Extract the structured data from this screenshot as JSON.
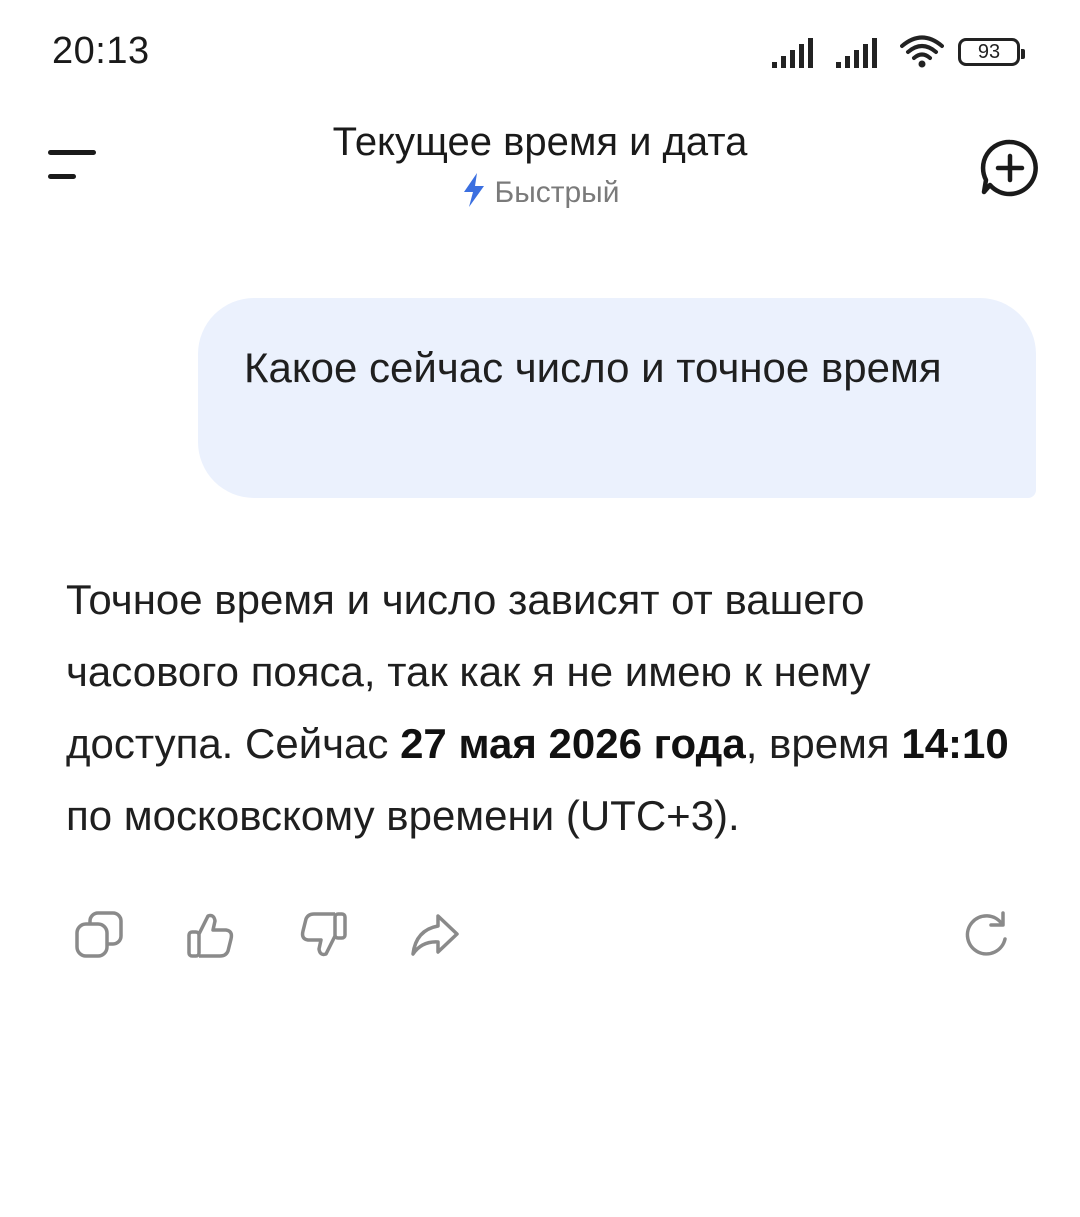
{
  "status_bar": {
    "time": "20:13",
    "battery": "93",
    "icons": [
      "signal-icon",
      "signal-icon",
      "wifi-icon",
      "battery-icon"
    ]
  },
  "header": {
    "title": "Текущее время и дата",
    "mode_label": "Быстрый",
    "mode_icon": "lightning-icon",
    "accent_color": "#3b6fe0"
  },
  "conversation": {
    "user_message": "Какое сейчас число и точное время",
    "assistant_reply": {
      "part1": "Точное время и число зависят от вашего часового пояса, так как я не имею к нему доступа. Сейчас ",
      "date_bold": "27 мая 2026 года",
      "part2": ", время ",
      "time_bold": "14:10",
      "part3": " по московскому времени (UTC+3)."
    }
  },
  "actions": {
    "icons": [
      "copy-icon",
      "thumbs-up-icon",
      "thumbs-down-icon",
      "share-icon",
      "regenerate-icon"
    ]
  },
  "colors": {
    "user_bubble": "#ebf1fd",
    "text": "#1f1f1f",
    "icon_gray": "#8a8a8a"
  }
}
